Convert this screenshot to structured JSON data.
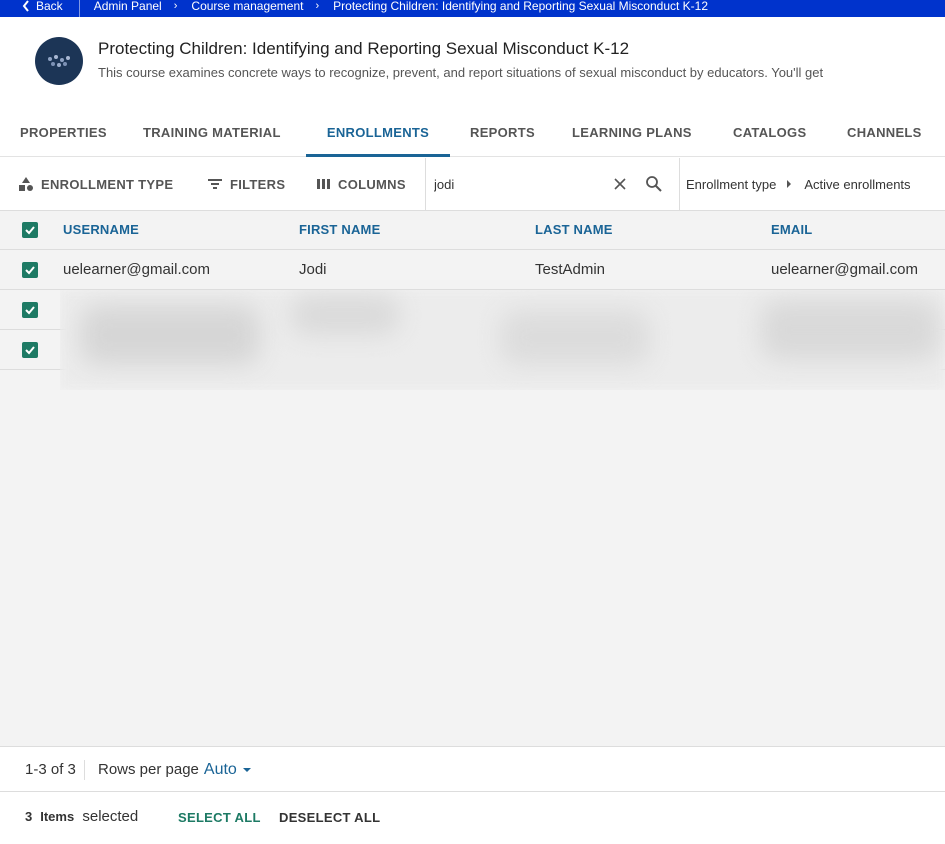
{
  "breadcrumb": {
    "back": "Back",
    "items": [
      "Admin Panel",
      "Course management",
      "Protecting Children: Identifying and Reporting Sexual Misconduct K-12"
    ]
  },
  "course": {
    "title": "Protecting Children: Identifying and Reporting Sexual Misconduct K-12",
    "description": "This course examines concrete ways to recognize, prevent, and report situations of sexual misconduct by educators. You'll get"
  },
  "tabs": [
    {
      "label": "PROPERTIES"
    },
    {
      "label": "TRAINING MATERIAL"
    },
    {
      "label": "ENROLLMENTS",
      "active": true
    },
    {
      "label": "REPORTS"
    },
    {
      "label": "LEARNING PLANS"
    },
    {
      "label": "CATALOGS"
    },
    {
      "label": "CHANNELS"
    }
  ],
  "toolbar": {
    "enrollment_type": "ENROLLMENT TYPE",
    "filters": "FILTERS",
    "columns": "COLUMNS",
    "search_value": "jodi",
    "filter_chip_key": "Enrollment type",
    "filter_chip_value": "Active enrollments"
  },
  "table": {
    "columns": [
      "USERNAME",
      "FIRST NAME",
      "LAST NAME",
      "EMAIL"
    ],
    "rows": [
      {
        "username": "uelearner@gmail.com",
        "first_name": "Jodi",
        "last_name": "TestAdmin",
        "email": "uelearner@gmail.com",
        "selected": true
      },
      {
        "username": "",
        "first_name": "",
        "last_name": "",
        "email": "",
        "selected": true,
        "redacted": true
      },
      {
        "username": "",
        "first_name": "",
        "last_name": "",
        "email": "",
        "selected": true,
        "redacted": true
      }
    ]
  },
  "pagination": {
    "range": "1-3 of 3",
    "rows_per_page_label": "Rows per page",
    "rows_per_page_value": "Auto"
  },
  "selection": {
    "count": "3",
    "label_bold": "Items",
    "label": "selected",
    "select_all": "SELECT ALL",
    "deselect_all": "DESELECT ALL"
  },
  "colors": {
    "topbar": "#0033cc",
    "accent": "#1a6496",
    "checkbox": "#1d7a64",
    "select_all": "#1d7a64"
  }
}
